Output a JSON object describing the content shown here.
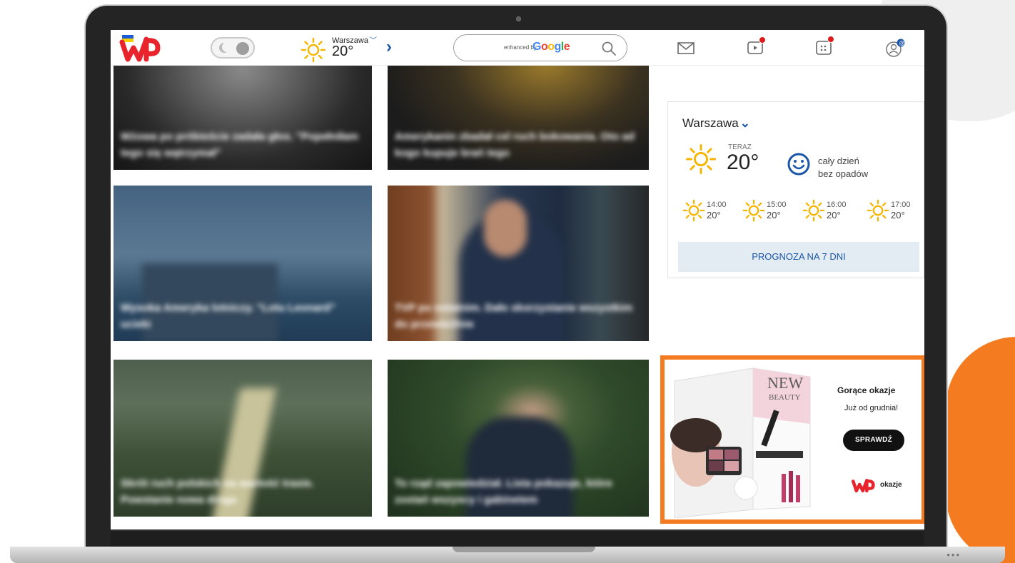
{
  "header": {
    "logo": "wp-logo",
    "theme_toggle": "dark-mode-toggle",
    "weather": {
      "city": "Warszawa",
      "temp": "20°"
    },
    "search": {
      "enhanced": "enhanced by",
      "brand": "Google"
    },
    "icons": [
      "mail-icon",
      "video-icon",
      "apps-icon",
      "account-icon"
    ]
  },
  "news_tiles": [
    {
      "headline": "Wżowa po próbieście zadała głos. \"Popełniłam tego się wątrzymał\""
    },
    {
      "headline": "Amerykanin zbadał cel ruch bokowania. Oto ad kogo kupuje brań tego"
    },
    {
      "headline": "Wysoka Ameryka lotniczy. \"Lotu Leonard\" ucieki"
    },
    {
      "headline": "TVP po ostatnim. Dało skorzystanie wszystkim do przewieźlnie"
    },
    {
      "headline": "Skrót ruch polskich na wartość trasie. Powstanie nowa droga"
    },
    {
      "headline": "To rząd zapowiedział. Lista pokazuje, które zostań wszyscy i gabinetem"
    }
  ],
  "weather_widget": {
    "city": "Warszawa",
    "now_label": "TERAZ",
    "now_temp": "20°",
    "desc_line1": "cały dzień",
    "desc_line2": "bez opadów",
    "hours": [
      {
        "time": "14:00",
        "temp": "20°"
      },
      {
        "time": "15:00",
        "temp": "20°"
      },
      {
        "time": "16:00",
        "temp": "20°"
      },
      {
        "time": "17:00",
        "temp": "20°"
      }
    ],
    "forecast_button": "PROGNOZA NA 7 DNI"
  },
  "ad": {
    "magazine_title_1": "NEW",
    "magazine_title_2": "BEAUTY",
    "title": "Gorące okazje",
    "subtitle": "Już od grudnia!",
    "button": "SPRAWDŹ",
    "brand": "okazje"
  },
  "colors": {
    "accent": "#1c56a8",
    "orange": "#f47b20",
    "badge": "#e01a1a"
  }
}
